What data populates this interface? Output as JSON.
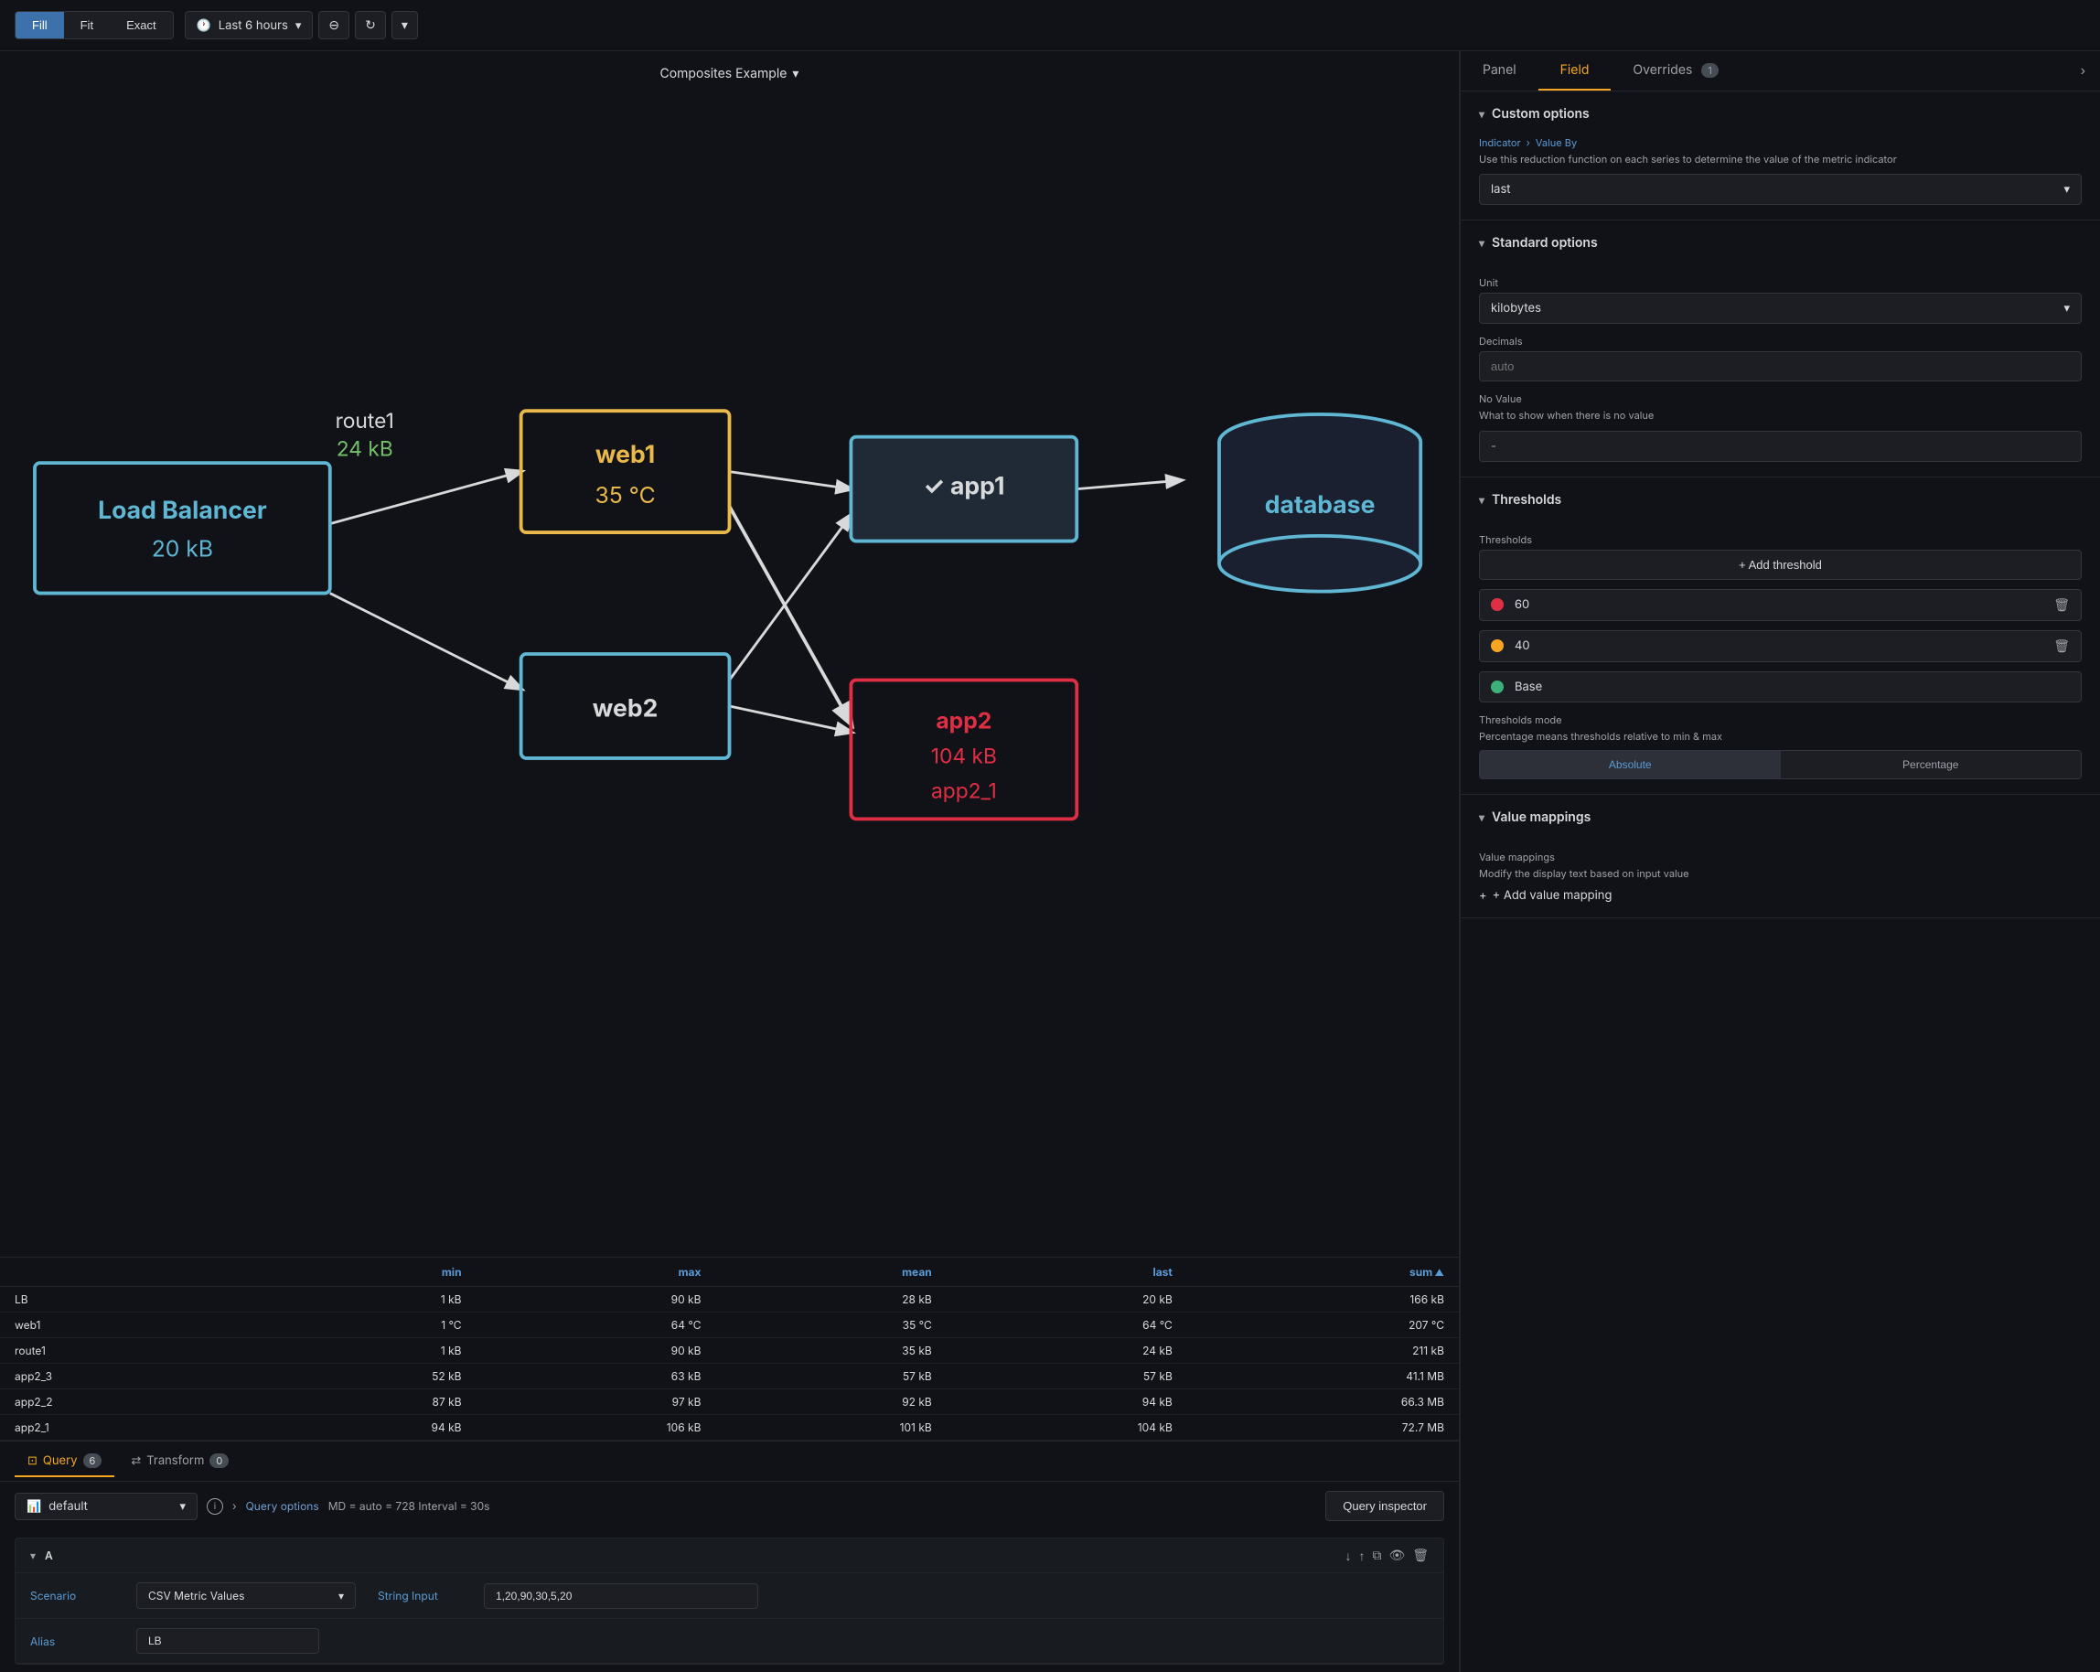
{
  "toolbar": {
    "fill_label": "Fill",
    "fit_label": "Fit",
    "exact_label": "Exact",
    "time_label": "Last 6 hours",
    "zoom_icon": "⊖",
    "refresh_icon": "↻",
    "chevron_icon": "▾",
    "clock_icon": "🕐"
  },
  "canvas": {
    "title": "Composites Example",
    "nodes": {
      "lb": {
        "label": "Load Balancer",
        "value": "20 kB"
      },
      "web1": {
        "label": "web1",
        "value": "35 °C"
      },
      "web2": {
        "label": "web2"
      },
      "app1": {
        "label": "app1",
        "check": "✓"
      },
      "app2": {
        "label": "app2",
        "value": "104 kB",
        "sub": "app2_1"
      },
      "database": {
        "label": "database"
      },
      "route1": "route1",
      "route1_val": "24 kB"
    }
  },
  "table": {
    "columns": [
      "",
      "min",
      "max",
      "mean",
      "last",
      "sum"
    ],
    "rows": [
      {
        "name": "LB",
        "min": "1 kB",
        "max": "90 kB",
        "mean": "28 kB",
        "last": "20 kB",
        "sum": "166 kB"
      },
      {
        "name": "web1",
        "min": "1 °C",
        "max": "64 °C",
        "mean": "35 °C",
        "last": "64 °C",
        "sum": "207 °C"
      },
      {
        "name": "route1",
        "min": "1 kB",
        "max": "90 kB",
        "mean": "35 kB",
        "last": "24 kB",
        "sum": "211 kB"
      },
      {
        "name": "app2_3",
        "min": "52 kB",
        "max": "63 kB",
        "mean": "57 kB",
        "last": "57 kB",
        "sum": "41.1 MB"
      },
      {
        "name": "app2_2",
        "min": "87 kB",
        "max": "97 kB",
        "mean": "92 kB",
        "last": "94 kB",
        "sum": "66.3 MB"
      },
      {
        "name": "app2_1",
        "min": "94 kB",
        "max": "106 kB",
        "mean": "101 kB",
        "last": "104 kB",
        "sum": "72.7 MB"
      }
    ]
  },
  "tabs": {
    "query": {
      "label": "Query",
      "badge": "6"
    },
    "transform": {
      "label": "Transform",
      "badge": "0"
    }
  },
  "query_row": {
    "datasource": "default",
    "datasource_icon": "📊",
    "info_icon": "ℹ",
    "options_label": "Query options",
    "options_meta": "MD = auto = 728  Interval = 30s",
    "inspector_label": "Query inspector"
  },
  "query_a": {
    "title": "A",
    "scenario_label": "Scenario",
    "scenario_value": "CSV Metric Values",
    "string_input_label": "String Input",
    "string_input_value": "1,20,90,30,5,20",
    "alias_label": "Alias",
    "alias_value": "LB"
  },
  "right_panel": {
    "tabs": [
      {
        "label": "Panel"
      },
      {
        "label": "Field",
        "active": true
      },
      {
        "label": "Overrides",
        "badge": "1"
      }
    ],
    "expand_icon": "›",
    "sections": {
      "custom_options": {
        "title": "Custom options",
        "indicator_breadcrumb": "Indicator  >  Value By",
        "description": "Use this reduction function on each series to determine the value of the metric indicator",
        "value_by": "last"
      },
      "standard_options": {
        "title": "Standard options",
        "unit_label": "Unit",
        "unit_value": "kilobytes",
        "decimals_label": "Decimals",
        "decimals_placeholder": "auto",
        "no_value_label": "No Value",
        "no_value_description": "What to show when there is no value",
        "no_value_placeholder": "-"
      },
      "thresholds": {
        "title": "Thresholds",
        "label": "Thresholds",
        "add_label": "+ Add threshold",
        "items": [
          {
            "color": "#e02f44",
            "value": "60"
          },
          {
            "color": "#f5a623",
            "value": "40"
          },
          {
            "color": "#3cb179",
            "value": "Base"
          }
        ],
        "mode_label": "Thresholds mode",
        "mode_description": "Percentage means thresholds relative to min & max",
        "modes": [
          {
            "label": "Absolute",
            "active": true
          },
          {
            "label": "Percentage",
            "active": false
          }
        ]
      },
      "value_mappings": {
        "title": "Value mappings",
        "label": "Value mappings",
        "description": "Modify the display text based on input value",
        "add_label": "+ Add value mapping"
      }
    }
  }
}
